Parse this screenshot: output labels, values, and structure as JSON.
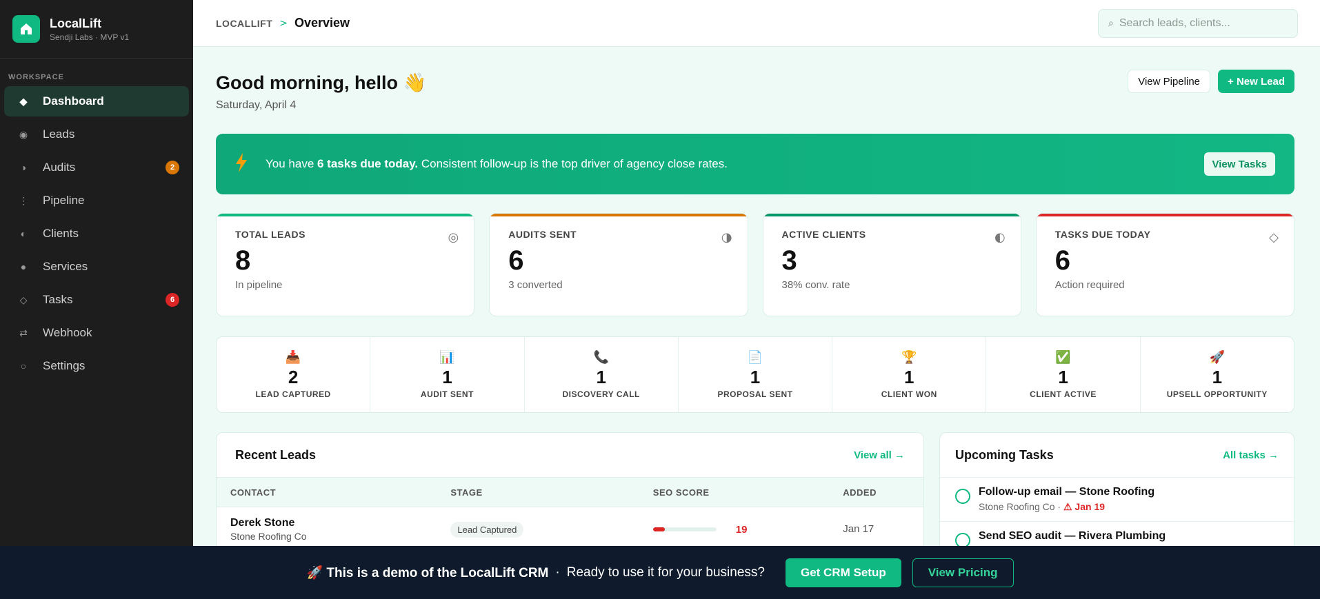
{
  "brand": {
    "name": "LocalLift",
    "subtitle": "Sendji Labs · MVP v1"
  },
  "sidebar": {
    "section_label": "WORKSPACE",
    "items": [
      {
        "label": "Dashboard",
        "icon": "diamond-icon",
        "active": true
      },
      {
        "label": "Leads",
        "icon": "target-icon"
      },
      {
        "label": "Audits",
        "icon": "half-circle-icon",
        "badge": "2",
        "badge_color": "#d97706"
      },
      {
        "label": "Pipeline",
        "icon": "vertical-dots-icon"
      },
      {
        "label": "Clients",
        "icon": "half-circle-icon"
      },
      {
        "label": "Services",
        "icon": "dot-icon"
      },
      {
        "label": "Tasks",
        "icon": "diamond-outline-icon",
        "badge": "6",
        "badge_color": "#dc2626"
      },
      {
        "label": "Webhook",
        "icon": "arrows-icon"
      },
      {
        "label": "Settings",
        "icon": "ring-icon"
      }
    ]
  },
  "topbar": {
    "crumb_root": "LOCALLIFT",
    "crumb_sep": ">",
    "crumb_current": "Overview",
    "search_placeholder": "Search leads, clients..."
  },
  "header": {
    "greeting": "Good morning, hello 👋",
    "date": "Saturday, April 4",
    "view_pipeline": "View Pipeline",
    "new_lead": "+ New Lead"
  },
  "banner": {
    "prefix": "You have ",
    "strong": "6 tasks due today.",
    "suffix": " Consistent follow-up is the top driver of agency close rates.",
    "button": "View Tasks"
  },
  "stats": [
    {
      "label": "TOTAL LEADS",
      "value": "8",
      "sub": "In pipeline",
      "icon": "◎",
      "color": "#10b981"
    },
    {
      "label": "AUDITS SENT",
      "value": "6",
      "sub": "3 converted",
      "icon": "◑",
      "color": "#d97706"
    },
    {
      "label": "ACTIVE CLIENTS",
      "value": "3",
      "sub": "38% conv. rate",
      "icon": "◐",
      "color": "#059669"
    },
    {
      "label": "TASKS DUE TODAY",
      "value": "6",
      "sub": "Action required",
      "icon": "◇",
      "color": "#dc2626"
    }
  ],
  "pipeline": [
    {
      "icon": "📥",
      "count": "2",
      "label": "LEAD CAPTURED"
    },
    {
      "icon": "📊",
      "count": "1",
      "label": "AUDIT SENT"
    },
    {
      "icon": "📞",
      "count": "1",
      "label": "DISCOVERY CALL"
    },
    {
      "icon": "📄",
      "count": "1",
      "label": "PROPOSAL SENT"
    },
    {
      "icon": "🏆",
      "count": "1",
      "label": "CLIENT WON"
    },
    {
      "icon": "✅",
      "count": "1",
      "label": "CLIENT ACTIVE"
    },
    {
      "icon": "🚀",
      "count": "1",
      "label": "UPSELL OPPORTUNITY"
    }
  ],
  "recent_leads": {
    "title": "Recent Leads",
    "link": "View all →",
    "columns": [
      "CONTACT",
      "STAGE",
      "SEO SCORE",
      "ADDED"
    ],
    "rows": [
      {
        "name": "Derek Stone",
        "company": "Stone Roofing Co",
        "stage": "Lead Captured",
        "seo": "19",
        "seo_fraction": 0.19,
        "added": "Jan 17"
      }
    ]
  },
  "upcoming_tasks": {
    "title": "Upcoming Tasks",
    "link": "All tasks →",
    "items": [
      {
        "title": "Follow-up email — Stone Roofing",
        "company": "Stone Roofing Co",
        "sep": " · ",
        "due": "⚠ Jan 19"
      },
      {
        "title": "Send SEO audit — Rivera Plumbing",
        "company": "",
        "sep": "",
        "due": ""
      }
    ]
  },
  "demo_bar": {
    "strong": "🚀 This is a demo of the LocalLift CRM",
    "dot": "·",
    "text": "Ready to use it for your business?",
    "primary": "Get CRM Setup",
    "secondary": "View Pricing"
  }
}
